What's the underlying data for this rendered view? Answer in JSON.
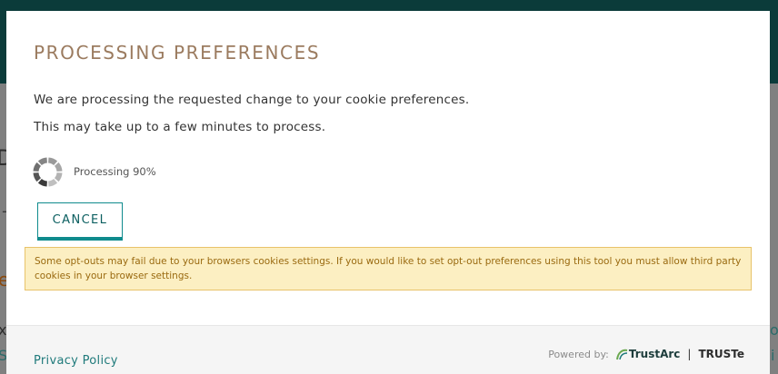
{
  "dialog": {
    "title": "PROCESSING PREFERENCES",
    "message_line1": "We are processing the requested change to your cookie preferences.",
    "message_line2": "This may take up to a few minutes to process.",
    "progress": {
      "label": "Processing 90%",
      "percent": 90
    },
    "cancel_label": "CANCEL",
    "warning": "Some opt-outs may fail due to your browsers cookies settings. If you would like to set opt-out preferences using this tool you must allow third party cookies in your browser settings."
  },
  "footer": {
    "privacy_label": "Privacy Policy",
    "powered_by": "Powered by:",
    "brand_trustarc": "TrustArc",
    "brand_separator": "|",
    "brand_truste": "TRUSTe"
  },
  "colors": {
    "header_bg": "#0b3b3a",
    "title": "#9b7b5f",
    "accent": "#0f8b8d",
    "warning_bg": "#fcefc2",
    "warning_text": "#9a6a10",
    "link": "#1f7a7b"
  },
  "icons": {
    "spinner": "loading-spinner-icon",
    "trustarc": "trustarc-logo-icon"
  }
}
